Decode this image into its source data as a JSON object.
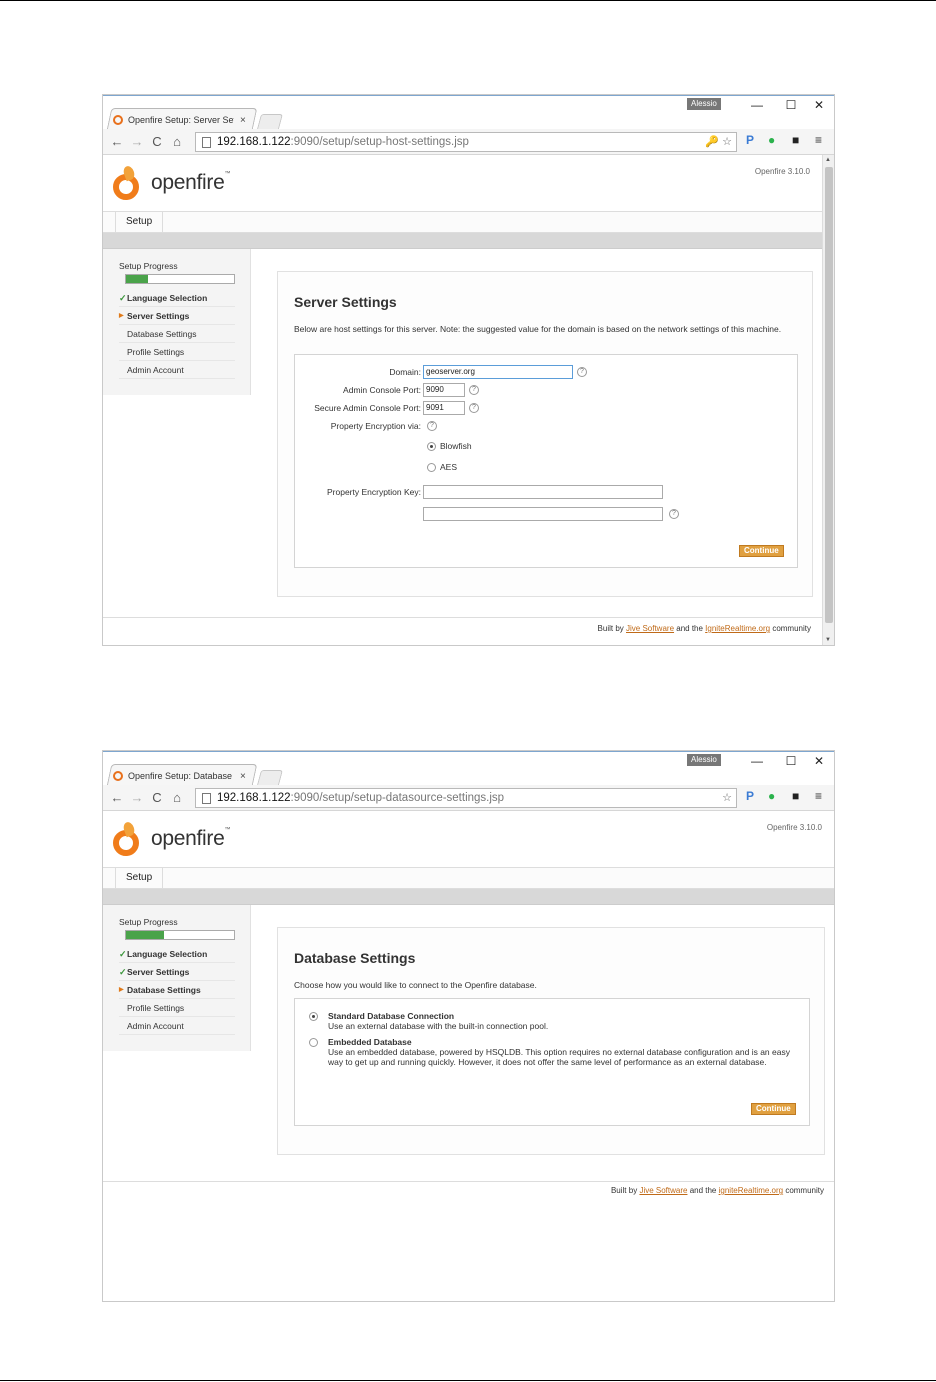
{
  "shot1": {
    "tab_title": "Openfire Setup: Server Setti",
    "tab_close": "×",
    "user_badge": "Alessio",
    "url_host": "192.168.1.122",
    "url_path": ":9090/setup/setup-host-settings.jsp",
    "omni_icons": "🔑 ☆",
    "version": "Openfire 3.10.0",
    "setup_tab": "Setup",
    "progress_title": "Setup Progress",
    "progress_value": 0.2,
    "steps": [
      {
        "label": "Language Selection",
        "state": "done"
      },
      {
        "label": "Server Settings",
        "state": "current"
      },
      {
        "label": "Database Settings",
        "state": "todo"
      },
      {
        "label": "Profile Settings",
        "state": "todo"
      },
      {
        "label": "Admin Account",
        "state": "todo"
      }
    ],
    "heading": "Server Settings",
    "description": "Below are host settings for this server. Note: the suggested value for the domain is based on the network settings of this machine.",
    "domain_label": "Domain:",
    "domain_value": "geoserver.org",
    "admin_port_label": "Admin Console Port:",
    "admin_port_value": "9090",
    "secure_port_label": "Secure Admin Console Port:",
    "secure_port_value": "9091",
    "encryption_label": "Property Encryption via:",
    "radio_blowfish": "Blowfish",
    "radio_aes": "AES",
    "key_label": "Property Encryption Key:",
    "continue_label": "Continue",
    "footer_prefix": "Built by ",
    "footer_link1": "Jive Software",
    "footer_mid": " and the ",
    "footer_link2": "IgniteRealtime.org",
    "footer_suffix": " community"
  },
  "shot2": {
    "tab_title": "Openfire Setup: Database S",
    "tab_close": "×",
    "user_badge": "Alessio",
    "url_host": "192.168.1.122",
    "url_path": ":9090/setup/setup-datasource-settings.jsp",
    "omni_icons": "☆",
    "version": "Openfire 3.10.0",
    "setup_tab": "Setup",
    "progress_title": "Setup Progress",
    "progress_value": 0.35,
    "steps": [
      {
        "label": "Language Selection",
        "state": "done"
      },
      {
        "label": "Server Settings",
        "state": "done"
      },
      {
        "label": "Database Settings",
        "state": "current"
      },
      {
        "label": "Profile Settings",
        "state": "todo"
      },
      {
        "label": "Admin Account",
        "state": "todo"
      }
    ],
    "heading": "Database Settings",
    "description": "Choose how you would like to connect to the Openfire database.",
    "opt1_title": "Standard Database Connection",
    "opt1_desc": "Use an external database with the built-in connection pool.",
    "opt2_title": "Embedded Database",
    "opt2_desc": "Use an embedded database, powered by HSQLDB. This option requires no external database configuration and is an easy way to get up and running quickly. However, it does not offer the same level of performance as an external database.",
    "continue_label": "Continue",
    "footer_prefix": "Built by ",
    "footer_link1": "Jive Software",
    "footer_mid": " and the ",
    "footer_link2": "igniteRealtime.org",
    "footer_suffix": " community"
  },
  "browser_chrome": {
    "logo_text": "openfire",
    "logo_tm": "™",
    "minimize": "—",
    "maximize": "☐",
    "close": "✕",
    "back": "←",
    "forward": "→",
    "reload": "C",
    "home": "⌂",
    "ext_p": "P",
    "ext_leaf": "●",
    "ext_box": "■",
    "ext_menu": "≡",
    "help": "?",
    "check": "✓",
    "arrow": "▶",
    "scroll_up": "▲",
    "scroll_down": "▼"
  }
}
